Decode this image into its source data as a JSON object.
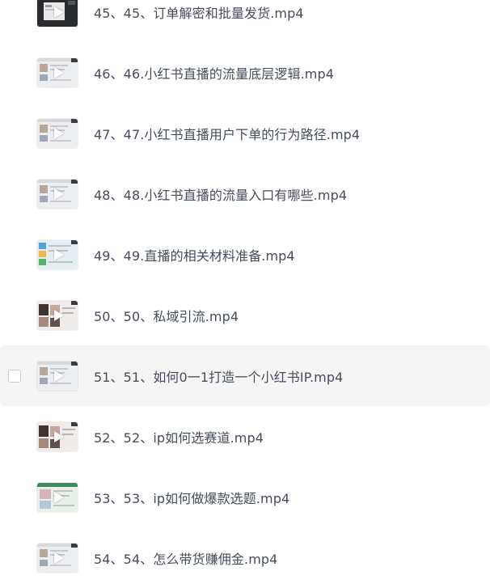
{
  "files": [
    {
      "name": "45、45、订单解密和批量发货.mp4",
      "thumb_icon": "video-thumbnail-icon",
      "thumb_style": "dark"
    },
    {
      "name": "46、46.小红书直播的流量底层逻辑.mp4",
      "thumb_icon": "video-thumbnail-icon",
      "thumb_style": "light"
    },
    {
      "name": "47、47.小红书直播用户下单的行为路径.mp4",
      "thumb_icon": "video-thumbnail-icon",
      "thumb_style": "light"
    },
    {
      "name": "48、48.小红书直播的流量入口有哪些.mp4",
      "thumb_icon": "video-thumbnail-icon",
      "thumb_style": "light"
    },
    {
      "name": "49、49.直播的相关材料准备.mp4",
      "thumb_icon": "video-thumbnail-icon",
      "thumb_style": "colorful"
    },
    {
      "name": "50、50、私域引流.mp4",
      "thumb_icon": "video-thumbnail-icon",
      "thumb_style": "photo"
    },
    {
      "name": "51、51、如何0一1打造一个小红书IP.mp4",
      "thumb_icon": "video-thumbnail-icon",
      "thumb_style": "light",
      "hovered": true
    },
    {
      "name": "52、52、ip如何选赛道.mp4",
      "thumb_icon": "video-thumbnail-icon",
      "thumb_style": "photo"
    },
    {
      "name": "53、53、ip如何做爆款选题.mp4",
      "thumb_icon": "video-thumbnail-icon",
      "thumb_style": "green"
    },
    {
      "name": "54、54、怎么带货赚佣金.mp4",
      "thumb_icon": "video-thumbnail-icon",
      "thumb_style": "light"
    }
  ],
  "colors": {
    "text": "#454d5a",
    "hover_row_bg": "#f5f5f6",
    "checkbox_border": "#c9ccd1"
  }
}
